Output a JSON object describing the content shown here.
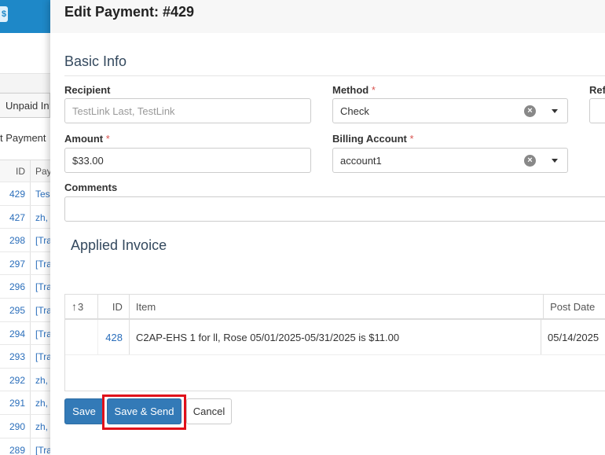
{
  "background": {
    "tab_label": "Unpaid Inv",
    "filter_label": "t Payment",
    "table": {
      "headers": {
        "id": "ID",
        "payee": "Pay"
      },
      "rows": [
        {
          "id": "429",
          "payee": "Tes"
        },
        {
          "id": "427",
          "payee": "zh,"
        },
        {
          "id": "298",
          "payee": "[Tra"
        },
        {
          "id": "297",
          "payee": "[Tra"
        },
        {
          "id": "296",
          "payee": "[Tra"
        },
        {
          "id": "295",
          "payee": "[Tra"
        },
        {
          "id": "294",
          "payee": "[Tra"
        },
        {
          "id": "293",
          "payee": "[Tra"
        },
        {
          "id": "292",
          "payee": "zh,"
        },
        {
          "id": "291",
          "payee": "zh,"
        },
        {
          "id": "290",
          "payee": "zh,"
        },
        {
          "id": "289",
          "payee": "[Tra"
        }
      ]
    }
  },
  "modal": {
    "title": "Edit Payment: #429",
    "basic_info_title": "Basic Info",
    "recipient": {
      "label": "Recipient",
      "placeholder": "TestLink Last, TestLink"
    },
    "method": {
      "label": "Method",
      "required": "*",
      "value": "Check"
    },
    "reference": {
      "label": "Refe"
    },
    "amount": {
      "label": "Amount",
      "required": "*",
      "value": "$33.00"
    },
    "billing_account": {
      "label": "Billing Account",
      "required": "*",
      "value": "account1"
    },
    "comments": {
      "label": "Comments",
      "value": ""
    },
    "applied_invoice_title": "Applied Invoice",
    "invoice_table": {
      "headers": {
        "sort": "3",
        "id": "ID",
        "item": "Item",
        "post_date": "Post Date"
      },
      "rows": [
        {
          "id": "428",
          "item": "C2AP-EHS 1 for ll, Rose 05/01/2025-05/31/2025 is $11.00",
          "post_date": "05/14/2025"
        }
      ]
    },
    "buttons": {
      "save": "Save",
      "save_send": "Save & Send",
      "cancel": "Cancel"
    }
  },
  "colors": {
    "primary": "#337ab7",
    "highlight": "#e0101a",
    "link": "#2a6ebb",
    "topbar": "#1e88c8"
  }
}
